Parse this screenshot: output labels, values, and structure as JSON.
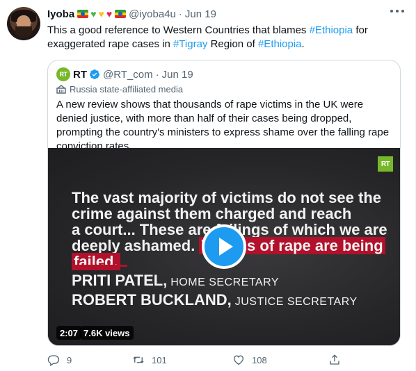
{
  "author": {
    "display_name": "Iyoba",
    "handle": "@iyoba4u",
    "separator": "·",
    "time": "Jun 19",
    "emoji_badges": [
      "ethiopia-flag",
      "green-heart",
      "yellow-heart",
      "red-heart",
      "ethiopia-flag"
    ]
  },
  "tweet": {
    "text_parts": [
      "This a good reference to Western Countries that blames ",
      "#Ethiopia",
      " for exaggerated rape cases in ",
      "#Tigray",
      " Region of ",
      "#Ethiopia",
      "."
    ]
  },
  "quoted": {
    "logo_text": "RT",
    "name": "RT",
    "handle": "@RT_com",
    "separator": "·",
    "time": "Jun 19",
    "label": "Russia state-affiliated media",
    "text": "A new review shows that thousands of rape victims in the UK were denied justice, with more than half of their cases being dropped, prompting the country's ministers to express shame over the falling rape conviction rates.",
    "video": {
      "badge": "RT",
      "line1": "The vast majority of victims do not see the",
      "line2": "crime against them charged and reach",
      "line3": "a court... These are failings of which we are",
      "line4_a": "deeply ashamed. ",
      "line4_b": "Victims of rape are being",
      "line5": "failed.",
      "name1": "PRITI PATEL,",
      "role1": " HOME SECRETARY",
      "name2": "ROBERT BUCKLAND,",
      "role2": " JUSTICE SECRETARY",
      "duration": "2:07",
      "views": "7.6K views"
    }
  },
  "actions": {
    "replies": "9",
    "retweets": "101",
    "likes": "108"
  },
  "colors": {
    "link": "#1d9bf0",
    "secondary_text": "#536471",
    "accent_red": "#b2102b",
    "rt_green": "#77b82a"
  }
}
